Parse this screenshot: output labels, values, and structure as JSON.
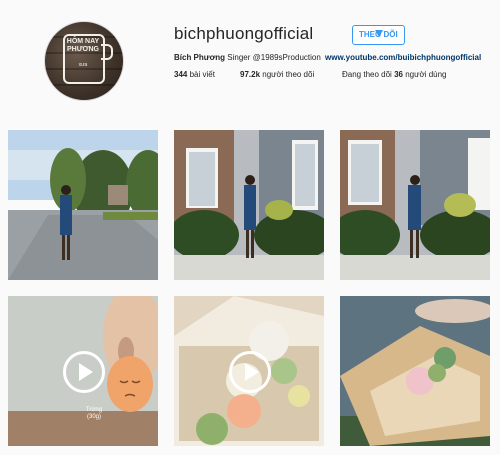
{
  "header": {
    "avatar_text_line1": "HÔM NAY PHƯƠNG",
    "avatar_text_line2": "xưa",
    "username": "bichphuongofficial",
    "follow_label": "THEO DÕI",
    "bio_name": "Bích Phương",
    "bio_desc": "Singer @1989sProduction",
    "bio_link": "www.youtube.com/buibichphuongofficial",
    "stats": {
      "posts_count": "344",
      "posts_label": "bài viết",
      "followers_count": "97.2k",
      "followers_label": "người theo dõi",
      "following_prefix": "Đang theo dõi",
      "following_count": "36",
      "following_label": "người dùng"
    }
  },
  "posts": [
    {
      "kind": "photo",
      "scene": "street"
    },
    {
      "kind": "photo",
      "scene": "house"
    },
    {
      "kind": "photo",
      "scene": "house2"
    },
    {
      "kind": "video",
      "scene": "egg",
      "caption_line1": "Trứng",
      "caption_line2": "(30g)"
    },
    {
      "kind": "video",
      "scene": "cakes"
    },
    {
      "kind": "photo",
      "scene": "box"
    }
  ],
  "icons": {
    "play": "play-icon",
    "dropdown": "triangle-down-icon"
  }
}
